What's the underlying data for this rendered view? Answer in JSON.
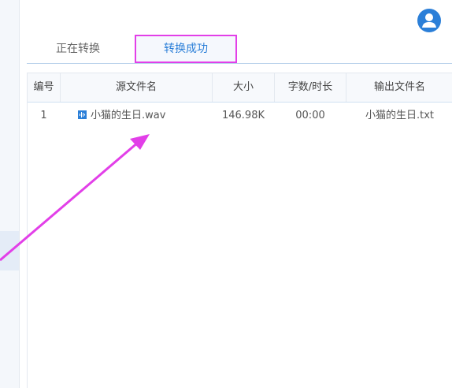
{
  "tabs": [
    {
      "label": "正在转换"
    },
    {
      "label": "转换成功"
    }
  ],
  "table": {
    "headers": [
      "编号",
      "源文件名",
      "大小",
      "字数/时长",
      "输出文件名"
    ],
    "rows": [
      {
        "num": "1",
        "source": "小猫的生日.wav",
        "size": "146.98K",
        "duration": "00:00",
        "output": "小猫的生日.txt"
      }
    ]
  },
  "colors": {
    "accent": "#2b7fd8",
    "annotation": "#e23fe8"
  },
  "icons": {
    "avatar": "user-avatar-icon",
    "file": "audio-file-icon"
  }
}
